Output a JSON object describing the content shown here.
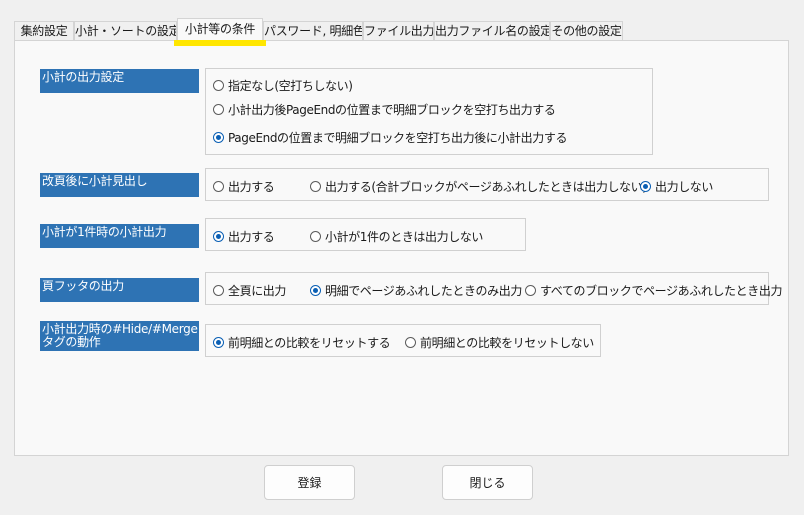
{
  "tabs": [
    {
      "label": "集約設定"
    },
    {
      "label": "小計・ソートの設定"
    },
    {
      "label": "小計等の条件"
    },
    {
      "label": "パスワード, 明細色"
    },
    {
      "label": "ファイル出力"
    },
    {
      "label": "出力ファイル名の設定"
    },
    {
      "label": "その他の設定"
    }
  ],
  "active_tab": "小計等の条件",
  "rows": [
    {
      "label": "小計の出力設定",
      "options": [
        "指定なし(空打ちしない)",
        "小計出力後PageEndの位置まで明細ブロックを空打ち出力する",
        "PageEndの位置まで明細ブロックを空打ち出力後に小計出力する"
      ],
      "selected": "PageEndの位置まで明細ブロックを空打ち出力後に小計出力する"
    },
    {
      "label": "改頁後に小計見出し",
      "options": [
        "出力する",
        "出力する(合計ブロックがページあふれしたときは出力しない)",
        "出力しない"
      ],
      "selected": "出力しない"
    },
    {
      "label": "小計が1件時の小計出力",
      "options": [
        "出力する",
        "小計が1件のときは出力しない"
      ],
      "selected": "出力する"
    },
    {
      "label": "頁フッタの出力",
      "options": [
        "全頁に出力",
        "明細でページあふれしたときのみ出力",
        "すべてのブロックでページあふれしたとき出力"
      ],
      "selected": "明細でページあふれしたときのみ出力"
    },
    {
      "label": "小計出力時の#Hide/#Mergeタグの動作",
      "options": [
        "前明細との比較をリセットする",
        "前明細との比較をリセットしない"
      ],
      "selected": "前明細との比較をリセットする"
    }
  ],
  "buttons": {
    "register": "登録",
    "close": "閉じる"
  },
  "colors": {
    "label_bg": "#2e73b4",
    "highlight": "#ffe600",
    "radio_selected": "#0a5fb4"
  }
}
